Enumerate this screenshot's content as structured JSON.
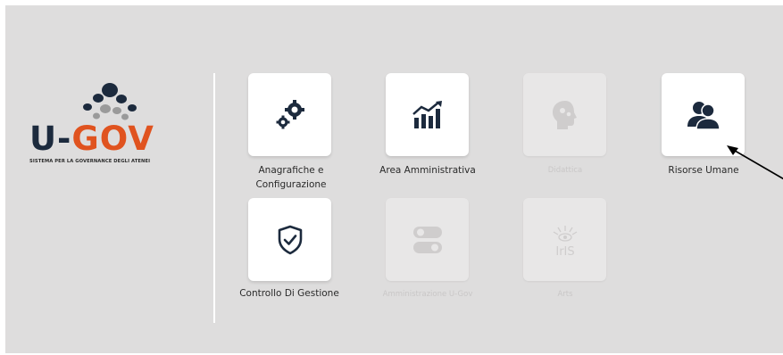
{
  "brand": {
    "name_left": "U-",
    "name_right": "GOV",
    "tagline": "SISTEMA PER LA GOVERNANCE DEGLI ATENEI",
    "colors": {
      "dark": "#1c2a3d",
      "accent": "#e0531f"
    }
  },
  "modules": [
    {
      "label": "Anagrafiche e Configurazione",
      "icon": "gears-icon",
      "enabled": true
    },
    {
      "label": "Area Amministrativa",
      "icon": "bar-chart-trend-icon",
      "enabled": true
    },
    {
      "label": "Didattica",
      "icon": "head-gears-icon",
      "enabled": false
    },
    {
      "label": "Risorse Umane",
      "icon": "users-icon",
      "enabled": true
    },
    {
      "label": "Controllo Di Gestione",
      "icon": "shield-check-icon",
      "enabled": true
    },
    {
      "label": "Amministrazione U-Gov",
      "icon": "toggles-icon",
      "enabled": false
    },
    {
      "label": "Arts",
      "icon": "iris-logo-icon",
      "enabled": false
    }
  ]
}
